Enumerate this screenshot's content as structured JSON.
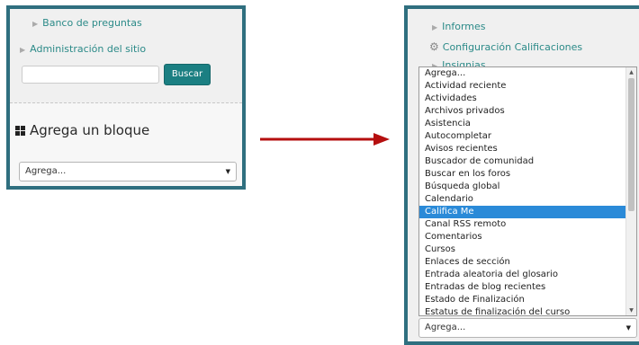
{
  "left_panel": {
    "nav_items": [
      "Banco de preguntas",
      "Administración del sitio"
    ],
    "search": {
      "value": "",
      "button_label": "Buscar"
    },
    "block": {
      "title": "Agrega un bloque",
      "select_value": "Agrega..."
    }
  },
  "right_panel": {
    "nav_items": [
      "Informes",
      "Configuración Calificaciones",
      "Insignias"
    ],
    "dropdown": {
      "options": [
        "Agrega...",
        "Actividad reciente",
        "Actividades",
        "Archivos privados",
        "Asistencia",
        "Autocompletar",
        "Avisos recientes",
        "Buscador de comunidad",
        "Buscar en los foros",
        "Búsqueda global",
        "Calendario",
        "Califica Me",
        "Canal RSS remoto",
        "Comentarios",
        "Cursos",
        "Enlaces de sección",
        "Entrada aleatoria del glosario",
        "Entradas de blog recientes",
        "Estado de Finalización",
        "Estatus de finalización del curso"
      ],
      "selected": "Califica Me",
      "select_value": "Agrega..."
    }
  },
  "colors": {
    "panel_border": "#2f6f7f",
    "link": "#2b8a88",
    "button": "#1b7f82",
    "selected_option": "#2a8ad8",
    "arrow": "#b50f0f"
  }
}
